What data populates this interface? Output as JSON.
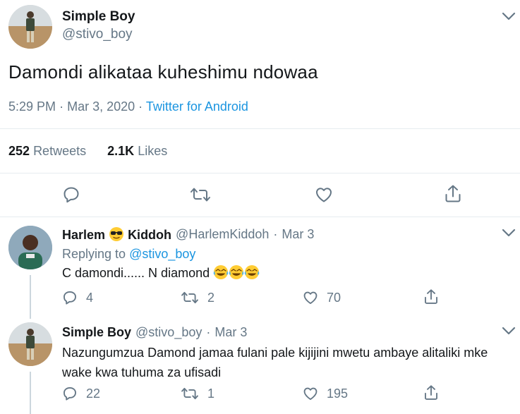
{
  "main_tweet": {
    "author_name": "Simple Boy",
    "author_handle": "@stivo_boy",
    "text": "Damondi alikataa kuheshimu ndowaa",
    "time": "5:29 PM",
    "separator": "·",
    "date": "Mar 3, 2020",
    "source": "Twitter for Android",
    "retweets_count": "252",
    "retweets_label": "Retweets",
    "likes_count": "2.1K",
    "likes_label": "Likes"
  },
  "replies": [
    {
      "author_name_part1": "Harlem",
      "author_name_part2": "Kiddoh",
      "author_handle": "@HarlemKiddoh",
      "separator": "·",
      "date": "Mar 3",
      "replying_prefix": "Replying to",
      "replying_to": "@stivo_boy",
      "text": "C damondi...... N diamond",
      "reply_count": "4",
      "retweet_count": "2",
      "like_count": "70"
    },
    {
      "author_name": "Simple Boy",
      "author_handle": "@stivo_boy",
      "separator": "·",
      "date": "Mar 3",
      "text": "Nazungumzua Damond jamaa fulani pale kijijini mwetu ambaye alitaliki mke wake kwa tuhuma za ufisadi",
      "reply_count": "22",
      "retweet_count": "1",
      "like_count": "195"
    }
  ],
  "colors": {
    "link": "#1b95e0",
    "muted": "#657786",
    "divider": "#e6ecf0"
  },
  "icons": [
    "chevron-down-icon",
    "reply-icon",
    "retweet-icon",
    "like-icon",
    "share-icon",
    "sunglasses-emoji-icon",
    "tears-of-joy-emoji-icon"
  ]
}
